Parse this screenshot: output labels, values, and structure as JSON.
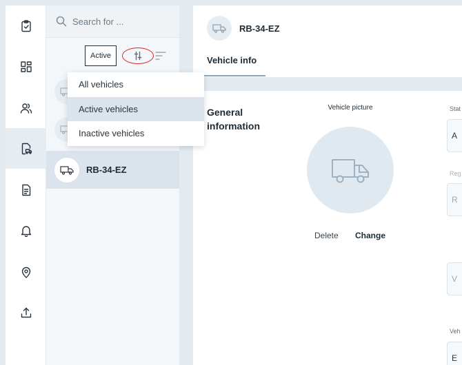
{
  "nav": {
    "items": [
      {
        "name": "tasks",
        "icon": "clipboard-check-icon"
      },
      {
        "name": "dashboard",
        "icon": "grid-icon"
      },
      {
        "name": "users",
        "icon": "users-icon"
      },
      {
        "name": "vehicles",
        "icon": "vehicle-document-icon"
      },
      {
        "name": "documents",
        "icon": "document-icon"
      },
      {
        "name": "notifications",
        "icon": "bell-icon"
      },
      {
        "name": "locations",
        "icon": "map-pin-icon"
      },
      {
        "name": "upload",
        "icon": "upload-icon"
      }
    ],
    "active": "vehicles"
  },
  "search": {
    "placeholder": "Search for ..."
  },
  "filter": {
    "active_label": "Active",
    "options": [
      "All vehicles",
      "Active vehicles",
      "Inactive vehicles"
    ],
    "selected": "Active vehicles"
  },
  "vehicles": {
    "selected_plate": "RB-34-EZ"
  },
  "detail": {
    "title": "RB-34-EZ",
    "tab_label": "Vehicle info",
    "section_title": "General information",
    "picture_label": "Vehicle picture",
    "delete_label": "Delete",
    "change_label": "Change",
    "fields": [
      {
        "label": "Stat",
        "value": "A"
      },
      {
        "label": "Reg",
        "value": "R"
      },
      {
        "label": "",
        "value": "V"
      },
      {
        "label": "Veh",
        "value": "E"
      }
    ]
  },
  "colors": {
    "accent": "#dbe4ec",
    "highlight_ring": "#e0262b",
    "background": "#e3ebf1"
  }
}
